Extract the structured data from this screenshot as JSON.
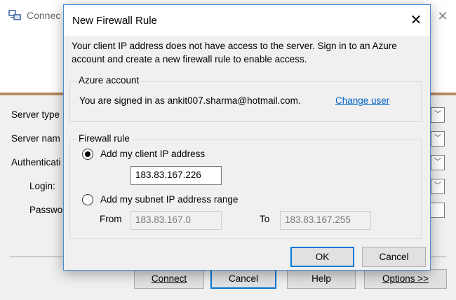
{
  "background_window": {
    "title": "Connect to Server",
    "title_visible": "Connec",
    "labels": {
      "server_type": "Server type",
      "server_name": "Server nam",
      "authentication": "Authenticati",
      "login": "Login:",
      "password": "Passwo"
    },
    "buttons": {
      "connect": "Connect",
      "cancel": "Cancel",
      "help": "Help",
      "options": "Options >>"
    },
    "accent_color": "#b78a61"
  },
  "dialog": {
    "title": "New Firewall Rule",
    "close_glyph": "✕",
    "message": "Your client IP address does not have access to the server. Sign in to an Azure account and create a new firewall rule to enable access.",
    "azure_account": {
      "group_title": "Azure account",
      "signed_in_text": "You are signed in as ankit007.sharma@hotmail.com.",
      "change_user_link": "Change user"
    },
    "firewall_rule": {
      "group_title": "Firewall rule",
      "option_client_ip": {
        "label": "Add my client IP address",
        "selected": true,
        "value": "183.83.167.226"
      },
      "option_subnet": {
        "label": "Add my subnet IP address range",
        "selected": false,
        "from_label": "From",
        "from_value": "183.83.167.0",
        "to_label": "To",
        "to_value": "183.83.167.255"
      }
    },
    "buttons": {
      "ok": "OK",
      "cancel": "Cancel"
    },
    "accent_color": "#0078d7",
    "link_color": "#0066cc"
  }
}
